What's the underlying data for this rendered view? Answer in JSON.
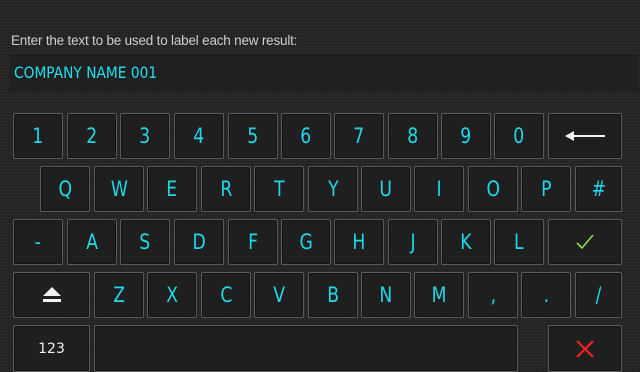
{
  "prompt": {
    "text": "Enter the text to be used to label each new result:"
  },
  "entry": {
    "value": "COMPANY NAME 001"
  },
  "keyboard": {
    "row1": [
      "1",
      "2",
      "3",
      "4",
      "5",
      "6",
      "7",
      "8",
      "9",
      "0"
    ],
    "row2": [
      "Q",
      "W",
      "E",
      "R",
      "T",
      "Y",
      "U",
      "I",
      "O",
      "P",
      "#"
    ],
    "row3": [
      "-",
      "A",
      "S",
      "D",
      "F",
      "G",
      "H",
      "J",
      "K",
      "L"
    ],
    "row4": [
      "Z",
      "X",
      "C",
      "V",
      "B",
      "N",
      "M",
      ",",
      ".",
      "/"
    ],
    "mode_key": "123",
    "backspace_icon": "backspace-arrow-icon",
    "enter_icon": "checkmark-icon",
    "shift_icon": "shift-icon",
    "cancel_icon": "cancel-x-icon",
    "colors": {
      "label": "#1fd8ea",
      "accept": "#8fe04a",
      "cancel": "#ff2020"
    }
  }
}
